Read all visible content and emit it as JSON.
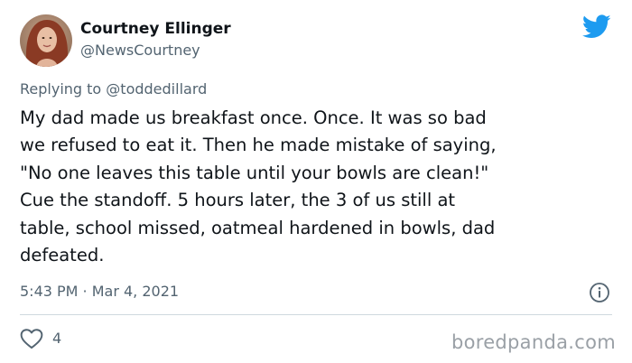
{
  "author": {
    "display_name": "Courtney Ellinger",
    "handle": "@NewsCourtney",
    "avatar_icon": "profile-photo"
  },
  "brand_icon": "twitter-bird-icon",
  "brand_color": "#1d9bf0",
  "reply": {
    "prefix": "Replying to",
    "mention": "@toddedillard"
  },
  "tweet": {
    "text": "My dad made us breakfast once. Once. It was so bad\nwe refused to eat it. Then he made mistake of saying,\n\"No one leaves this table until your bowls are clean!\"\nCue the standoff. 5 hours later, the 3 of us still at\ntable, school missed, oatmeal hardened in bowls, dad\ndefeated.",
    "timestamp": "5:43 PM · Mar 4, 2021"
  },
  "actions": {
    "like_count": "4",
    "like_icon": "heart-icon",
    "info_icon": "info-icon"
  },
  "watermark": "boredpanda.com"
}
